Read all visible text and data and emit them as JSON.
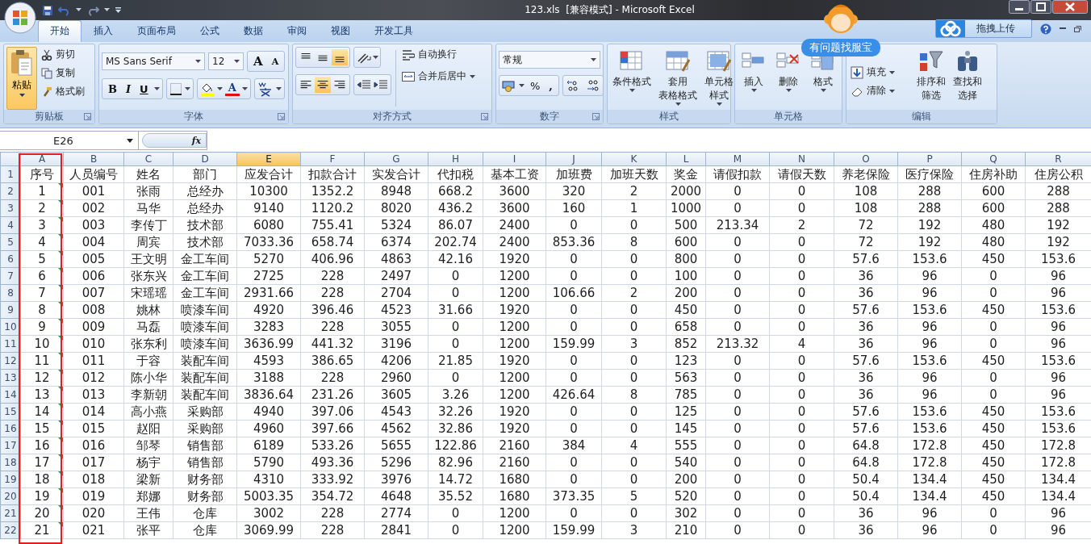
{
  "window": {
    "title": "123.xls  [兼容模式] - Microsoft Excel"
  },
  "tabs": [
    {
      "label": "开始",
      "selected": true
    },
    {
      "label": "插入",
      "selected": false
    },
    {
      "label": "页面布局",
      "selected": false
    },
    {
      "label": "公式",
      "selected": false
    },
    {
      "label": "数据",
      "selected": false
    },
    {
      "label": "审阅",
      "selected": false
    },
    {
      "label": "视图",
      "selected": false
    },
    {
      "label": "开发工具",
      "selected": false
    }
  ],
  "upload_button": {
    "label": "拖拽上传"
  },
  "help_badge": {
    "label": "有问题找服宝"
  },
  "ribbon": {
    "clipboard": {
      "label": "剪贴板",
      "paste": "粘贴",
      "items": [
        "剪切",
        "复制",
        "格式刷"
      ]
    },
    "font": {
      "label": "字体",
      "family": "MS Sans Serif",
      "size": "12",
      "grow": "A",
      "shrink": "A",
      "bold": "B",
      "italic": "I",
      "underline": "U",
      "font_color_button": "A"
    },
    "alignment": {
      "label": "对齐方式",
      "vertical": [
        {
          "selected": false
        },
        {
          "selected": false
        },
        {
          "selected": true
        }
      ],
      "horizontal": [
        {
          "selected": false
        },
        {
          "selected": true
        },
        {
          "selected": false
        }
      ],
      "wrap": "自动换行",
      "merge": "合并后居中"
    },
    "number": {
      "label": "数字",
      "format": "常规",
      "percent": "%",
      "comma": ","
    },
    "styles": {
      "label": "样式",
      "items": [
        [
          "条件格式"
        ],
        [
          "套用",
          "表格格式"
        ],
        [
          "单元格",
          "样式"
        ]
      ]
    },
    "cells": {
      "label": "单元格",
      "items": [
        "插入",
        "删除",
        "格式"
      ]
    },
    "editing": {
      "label": "编辑",
      "items": [
        "填充",
        "清除"
      ],
      "big": [
        [
          "排序和",
          "筛选"
        ],
        [
          "查找和",
          "选择"
        ]
      ]
    }
  },
  "formula_bar": {
    "name_box": "E26",
    "fx": "fx"
  },
  "sheet": {
    "columns": [
      {
        "letter": "A",
        "selected": false
      },
      {
        "letter": "B",
        "selected": false
      },
      {
        "letter": "C",
        "selected": false
      },
      {
        "letter": "D",
        "selected": false
      },
      {
        "letter": "E",
        "selected": true
      },
      {
        "letter": "F",
        "selected": false
      },
      {
        "letter": "G",
        "selected": false
      },
      {
        "letter": "H",
        "selected": false
      },
      {
        "letter": "I",
        "selected": false
      },
      {
        "letter": "J",
        "selected": false
      },
      {
        "letter": "K",
        "selected": false
      },
      {
        "letter": "L",
        "selected": false
      },
      {
        "letter": "M",
        "selected": false
      },
      {
        "letter": "N",
        "selected": false
      },
      {
        "letter": "O",
        "selected": false
      },
      {
        "letter": "P",
        "selected": false
      },
      {
        "letter": "Q",
        "selected": false
      },
      {
        "letter": "R",
        "selected": false
      }
    ],
    "rows": [
      {
        "number": "1",
        "flagged": false,
        "cells": [
          "序号",
          "人员编号",
          "姓名",
          "部门",
          "应发合计",
          "扣款合计",
          "实发合计",
          "代扣税",
          "基本工资",
          "加班费",
          "加班天数",
          "奖金",
          "请假扣款",
          "请假天数",
          "养老保险",
          "医疗保险",
          "住房补助",
          "住房公积"
        ]
      },
      {
        "number": "2",
        "flagged": true,
        "cells": [
          "1",
          "001",
          "张雨",
          "总经办",
          "10300",
          "1352.2",
          "8948",
          "668.2",
          "3600",
          "320",
          "2",
          "2000",
          "0",
          "0",
          "108",
          "288",
          "600",
          "288"
        ]
      },
      {
        "number": "3",
        "flagged": true,
        "cells": [
          "2",
          "002",
          "马华",
          "总经办",
          "9140",
          "1120.2",
          "8020",
          "436.2",
          "3600",
          "160",
          "1",
          "1000",
          "0",
          "0",
          "108",
          "288",
          "600",
          "288"
        ]
      },
      {
        "number": "4",
        "flagged": true,
        "cells": [
          "3",
          "003",
          "李传丁",
          "技术部",
          "6080",
          "755.41",
          "5324",
          "86.07",
          "2400",
          "0",
          "0",
          "500",
          "213.34",
          "2",
          "72",
          "192",
          "480",
          "192"
        ]
      },
      {
        "number": "5",
        "flagged": true,
        "cells": [
          "4",
          "004",
          "周宾",
          "技术部",
          "7033.36",
          "658.74",
          "6374",
          "202.74",
          "2400",
          "853.36",
          "8",
          "600",
          "0",
          "0",
          "72",
          "192",
          "480",
          "192"
        ]
      },
      {
        "number": "6",
        "flagged": true,
        "cells": [
          "5",
          "005",
          "王文明",
          "金工车间",
          "5270",
          "406.96",
          "4863",
          "42.16",
          "1920",
          "0",
          "0",
          "800",
          "0",
          "0",
          "57.6",
          "153.6",
          "450",
          "153.6"
        ]
      },
      {
        "number": "7",
        "flagged": true,
        "cells": [
          "6",
          "006",
          "张东兴",
          "金工车间",
          "2725",
          "228",
          "2497",
          "0",
          "1200",
          "0",
          "0",
          "100",
          "0",
          "0",
          "36",
          "96",
          "0",
          "96"
        ]
      },
      {
        "number": "8",
        "flagged": true,
        "cells": [
          "7",
          "007",
          "宋瑶瑶",
          "金工车间",
          "2931.66",
          "228",
          "2704",
          "0",
          "1200",
          "106.66",
          "2",
          "200",
          "0",
          "0",
          "36",
          "96",
          "0",
          "96"
        ]
      },
      {
        "number": "9",
        "flagged": true,
        "cells": [
          "8",
          "008",
          "姚林",
          "喷漆车间",
          "4920",
          "396.46",
          "4523",
          "31.66",
          "1920",
          "0",
          "0",
          "450",
          "0",
          "0",
          "57.6",
          "153.6",
          "450",
          "153.6"
        ]
      },
      {
        "number": "10",
        "flagged": true,
        "cells": [
          "9",
          "009",
          "马磊",
          "喷漆车间",
          "3283",
          "228",
          "3055",
          "0",
          "1200",
          "0",
          "0",
          "658",
          "0",
          "0",
          "36",
          "96",
          "0",
          "96"
        ]
      },
      {
        "number": "11",
        "flagged": true,
        "cells": [
          "10",
          "010",
          "张东利",
          "喷漆车间",
          "3636.99",
          "441.32",
          "3196",
          "0",
          "1200",
          "159.99",
          "3",
          "852",
          "213.32",
          "4",
          "36",
          "96",
          "0",
          "96"
        ]
      },
      {
        "number": "12",
        "flagged": true,
        "cells": [
          "11",
          "011",
          "于容",
          "装配车间",
          "4593",
          "386.65",
          "4206",
          "21.85",
          "1920",
          "0",
          "0",
          "123",
          "0",
          "0",
          "57.6",
          "153.6",
          "450",
          "153.6"
        ]
      },
      {
        "number": "13",
        "flagged": true,
        "cells": [
          "12",
          "012",
          "陈小华",
          "装配车间",
          "3188",
          "228",
          "2960",
          "0",
          "1200",
          "0",
          "0",
          "563",
          "0",
          "0",
          "36",
          "96",
          "0",
          "96"
        ]
      },
      {
        "number": "14",
        "flagged": true,
        "cells": [
          "13",
          "013",
          "李新朝",
          "装配车间",
          "3836.64",
          "231.26",
          "3605",
          "3.26",
          "1200",
          "426.64",
          "8",
          "785",
          "0",
          "0",
          "36",
          "96",
          "0",
          "96"
        ]
      },
      {
        "number": "15",
        "flagged": true,
        "cells": [
          "14",
          "014",
          "高小燕",
          "采购部",
          "4940",
          "397.06",
          "4543",
          "32.26",
          "1920",
          "0",
          "0",
          "125",
          "0",
          "0",
          "57.6",
          "153.6",
          "450",
          "153.6"
        ]
      },
      {
        "number": "16",
        "flagged": true,
        "cells": [
          "15",
          "015",
          "赵阳",
          "采购部",
          "4960",
          "397.66",
          "4562",
          "32.86",
          "1920",
          "0",
          "0",
          "145",
          "0",
          "0",
          "57.6",
          "153.6",
          "450",
          "153.6"
        ]
      },
      {
        "number": "17",
        "flagged": true,
        "cells": [
          "16",
          "016",
          "邹琴",
          "销售部",
          "6189",
          "533.26",
          "5655",
          "122.86",
          "2160",
          "384",
          "4",
          "555",
          "0",
          "0",
          "64.8",
          "172.8",
          "450",
          "172.8"
        ]
      },
      {
        "number": "18",
        "flagged": true,
        "cells": [
          "17",
          "017",
          "杨宇",
          "销售部",
          "5790",
          "493.36",
          "5296",
          "82.96",
          "2160",
          "0",
          "0",
          "540",
          "0",
          "0",
          "64.8",
          "172.8",
          "450",
          "172.8"
        ]
      },
      {
        "number": "19",
        "flagged": true,
        "cells": [
          "18",
          "018",
          "梁新",
          "财务部",
          "4310",
          "333.92",
          "3976",
          "14.72",
          "1680",
          "0",
          "0",
          "200",
          "0",
          "0",
          "50.4",
          "134.4",
          "450",
          "134.4"
        ]
      },
      {
        "number": "20",
        "flagged": true,
        "cells": [
          "19",
          "019",
          "郑娜",
          "财务部",
          "5003.35",
          "354.72",
          "4648",
          "35.52",
          "1680",
          "373.35",
          "5",
          "520",
          "0",
          "0",
          "50.4",
          "134.4",
          "450",
          "134.4"
        ]
      },
      {
        "number": "21",
        "flagged": true,
        "cells": [
          "20",
          "020",
          "王伟",
          "仓库",
          "3002",
          "228",
          "2774",
          "0",
          "1200",
          "0",
          "0",
          "302",
          "0",
          "0",
          "36",
          "96",
          "0",
          "96"
        ]
      },
      {
        "number": "22",
        "flagged": true,
        "cells": [
          "21",
          "021",
          "张平",
          "仓库",
          "3069.99",
          "228",
          "2841",
          "0",
          "1200",
          "159.99",
          "3",
          "210",
          "0",
          "0",
          "36",
          "96",
          "0",
          "96"
        ]
      }
    ]
  }
}
